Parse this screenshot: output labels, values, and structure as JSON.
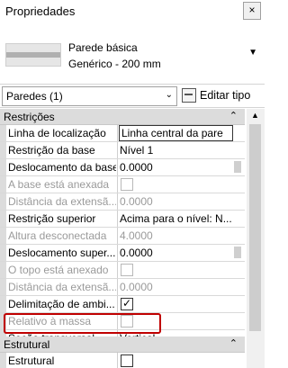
{
  "panel": {
    "title": "Propriedades",
    "close_glyph": "×"
  },
  "type_selector": {
    "family": "Parede básica",
    "type": "Genérico - 200 mm",
    "dropdown_glyph": "▼"
  },
  "instance_filter": {
    "value": "Paredes (1)",
    "arrow_glyph": "⌄",
    "edit_type_label": "Editar tipo"
  },
  "categories": {
    "restricoes": "Restrições",
    "estrutural": "Estrutural",
    "chevron": "⌃"
  },
  "properties": [
    {
      "name": "Linha de localização",
      "value": "Linha central da pare",
      "state": "editing"
    },
    {
      "name": "Restrição da base",
      "value": "Nível 1",
      "state": "normal"
    },
    {
      "name": "Deslocamento da base",
      "value": "0.0000",
      "state": "normal"
    },
    {
      "name": "A base está anexada",
      "value": "",
      "state": "disabled",
      "checkbox": false
    },
    {
      "name": "Distância da extensã...",
      "value": "0.0000",
      "state": "disabled"
    },
    {
      "name": "Restrição superior",
      "value": "Acima para o nível: N...",
      "state": "normal"
    },
    {
      "name": "Altura desconectada",
      "value": "4.0000",
      "state": "disabled"
    },
    {
      "name": "Deslocamento super...",
      "value": "0.0000",
      "state": "normal"
    },
    {
      "name": "O topo está anexado",
      "value": "",
      "state": "disabled",
      "checkbox": false
    },
    {
      "name": "Distância da extensã...",
      "value": "0.0000",
      "state": "disabled"
    },
    {
      "name": "Delimitação de ambi...",
      "value": "",
      "state": "normal",
      "checkbox": true
    },
    {
      "name": "Relativo à massa",
      "value": "",
      "state": "disabled",
      "checkbox": false
    },
    {
      "name": "Seção transversal",
      "value": "Vertical",
      "state": "highlighted"
    }
  ],
  "structural": [
    {
      "name": "Estrutural",
      "value": "",
      "state": "normal",
      "checkbox": false
    }
  ],
  "colors": {
    "highlight": "#c00000",
    "category_bg": "#dcdcdc",
    "disabled_text": "#9a9a9a"
  }
}
